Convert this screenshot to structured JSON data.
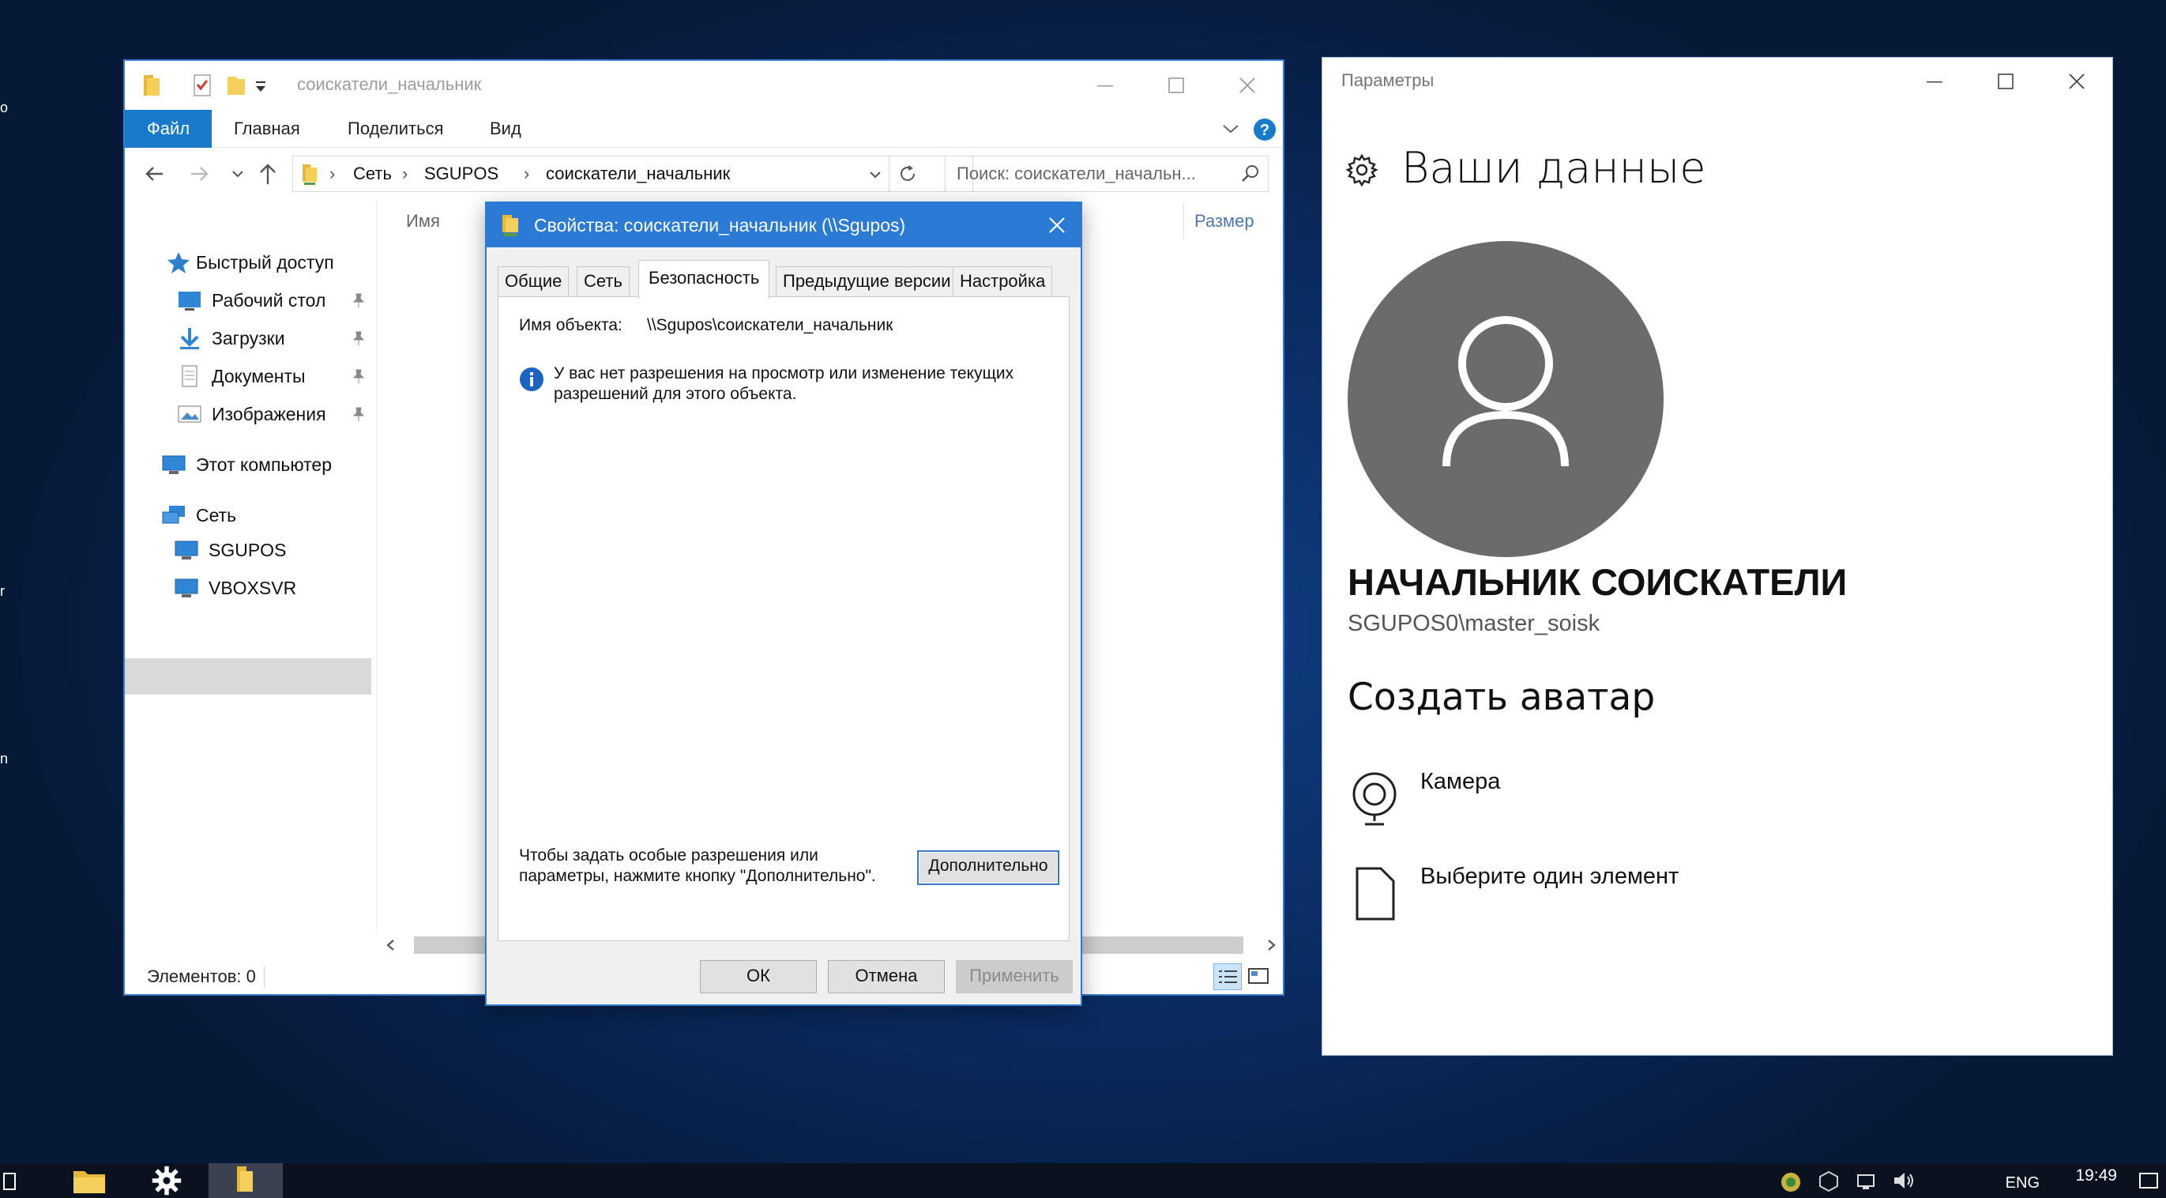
{
  "explorer": {
    "title": "соискатели_начальник",
    "ribbon_tabs": [
      "Файл",
      "Главная",
      "Поделиться",
      "Вид"
    ],
    "breadcrumb": [
      "Сеть",
      "SGUPOS",
      "соискатели_начальник"
    ],
    "search_placeholder": "Поиск: соискатели_начальн...",
    "nav": {
      "quick_access": "Быстрый доступ",
      "desktop": "Рабочий стол",
      "downloads": "Загрузки",
      "documents": "Документы",
      "pictures": "Изображения",
      "this_pc": "Этот компьютер",
      "network": "Сеть",
      "sgupos": "SGUPOS",
      "vboxsvr": "VBOXSVR"
    },
    "columns": {
      "name": "Имя",
      "size": "Размер"
    },
    "status": "Элементов: 0"
  },
  "dialog": {
    "title": "Свойства: соискатели_начальник (\\\\Sgupos)",
    "tabs": [
      "Общие",
      "Сеть",
      "Безопасность",
      "Предыдущие версии",
      "Настройка"
    ],
    "active_tab": "Безопасность",
    "object_label": "Имя объекта:",
    "object_value": "\\\\Sgupos\\соискатели_начальник",
    "info_text": "У вас нет разрешения на просмотр или изменение текущих разрешений для этого объекта.",
    "advanced_text": "Чтобы задать особые разрешения или параметры, нажмите кнопку \"Дополнительно\".",
    "advanced_button": "Дополнительно",
    "ok": "ОК",
    "cancel": "Отмена",
    "apply": "Применить"
  },
  "settings": {
    "window_title": "Параметры",
    "heading": "Ваши данные",
    "user_name": "НАЧАЛЬНИК СОИСКАТЕЛИ",
    "account": "SGUPOS0\\master_soisk",
    "create_avatar": "Создать аватар",
    "options": [
      "Камера",
      "Выберите один элемент"
    ]
  },
  "taskbar": {
    "lang": "ENG",
    "time": "19:49"
  },
  "colors": {
    "accent": "#1979ca",
    "dialog_title": "#2b7bd4",
    "avatar": "#6b6b6b"
  }
}
